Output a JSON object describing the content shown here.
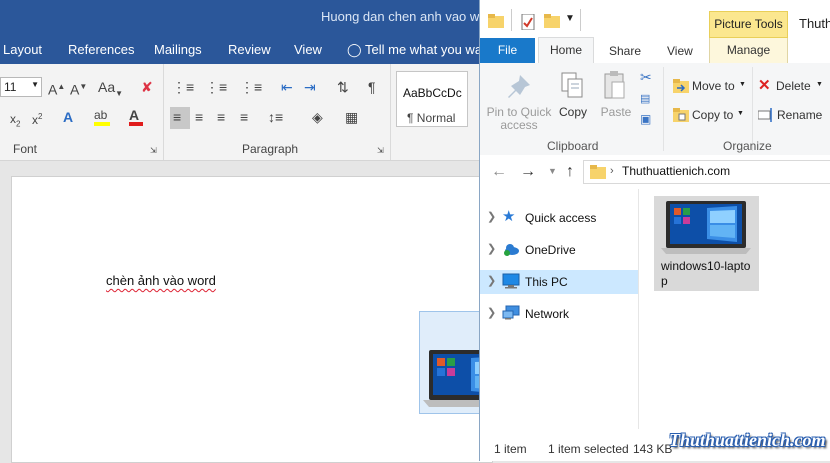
{
  "word": {
    "title": "Huong dan chen anh vao word",
    "tabs": [
      "Layout",
      "References",
      "Mailings",
      "Review",
      "View",
      "Tell me what you war"
    ],
    "font_size": "11",
    "style_preview": "AaBbCcDc",
    "style_name": "¶ Normal",
    "groups": {
      "font": "Font",
      "paragraph": "Paragraph"
    },
    "document_text": "chèn ảnh vào word"
  },
  "explorer": {
    "title": "Thuth",
    "picture_tools": "Picture Tools",
    "tabs": {
      "file": "File",
      "home": "Home",
      "share": "Share",
      "view": "View",
      "manage": "Manage"
    },
    "ribbon": {
      "pin": "Pin to Quick access",
      "copy": "Copy",
      "paste": "Paste",
      "move_to": "Move to",
      "copy_to": "Copy to",
      "delete": "Delete",
      "rename": "Rename",
      "clipboard": "Clipboard",
      "organize": "Organize"
    },
    "address": "Thuthuattienich.com",
    "nav": [
      {
        "label": "Quick access"
      },
      {
        "label": "OneDrive"
      },
      {
        "label": "This PC"
      },
      {
        "label": "Network"
      }
    ],
    "file": {
      "name": "windows10-laptop"
    },
    "status": {
      "items": "1 item",
      "selected": "1 item selected",
      "size": "143 KB"
    }
  },
  "watermark": "Thuthuattienich.com",
  "colors": {
    "word_blue": "#2b579a",
    "file_tab_blue": "#1979ca",
    "picture_tools_yellow": "#fbe78f",
    "selection_blue": "#cce8ff"
  }
}
